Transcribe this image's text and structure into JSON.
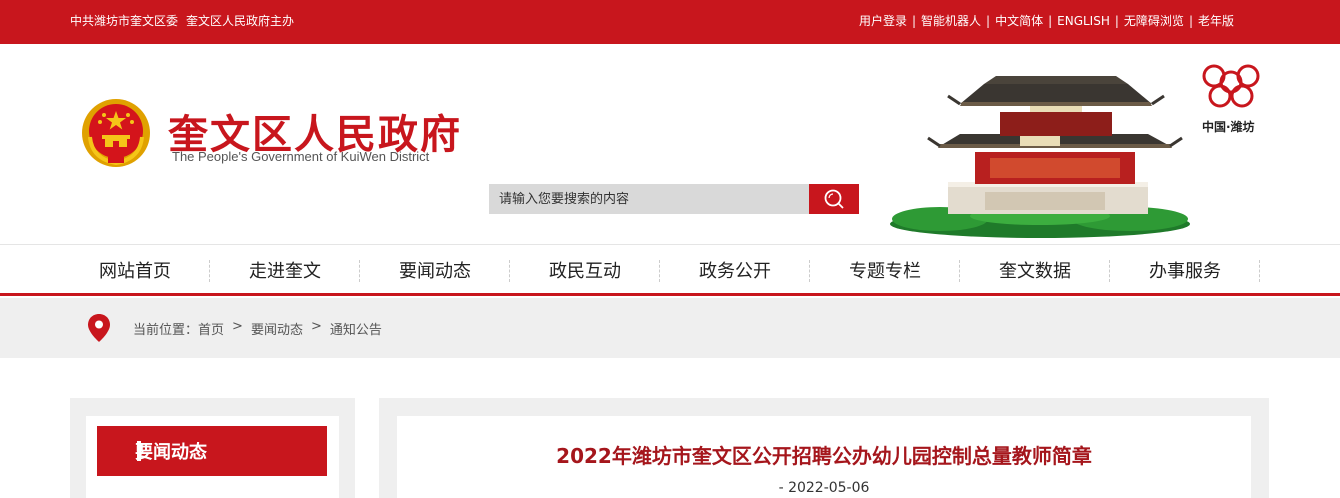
{
  "topbar": {
    "left_text": [
      "中共潍坊市奎文区委",
      "奎文区人民政府主办"
    ],
    "links": [
      "用户登录",
      "智能机器人",
      "中文简体",
      "ENGLISH",
      "无障碍浏览",
      "老年版"
    ],
    "separator": "|"
  },
  "header": {
    "title": "奎文区人民政府",
    "subtitle": "The People's Government of KuiWen District",
    "search_placeholder": "请输入您要搜索的内容",
    "weifang_logo_label": "中国·潍坊"
  },
  "nav": {
    "items": [
      "网站首页",
      "走进奎文",
      "要闻动态",
      "政民互动",
      "政务公开",
      "专题专栏",
      "奎文数据",
      "办事服务"
    ]
  },
  "breadcrumb": {
    "prefix": "当前位置：",
    "items": [
      "首页",
      "要闻动态",
      "通知公告"
    ],
    "separator": ">"
  },
  "sidebar": {
    "title": "要闻动态"
  },
  "article": {
    "title": "2022年潍坊市奎文区公开招聘公办幼儿园控制总量教师简章",
    "date": "- 2022-05-06"
  },
  "colors": {
    "brand_red": "#c8161d",
    "title_red": "#a5161c",
    "gray_bg": "#efefef"
  }
}
